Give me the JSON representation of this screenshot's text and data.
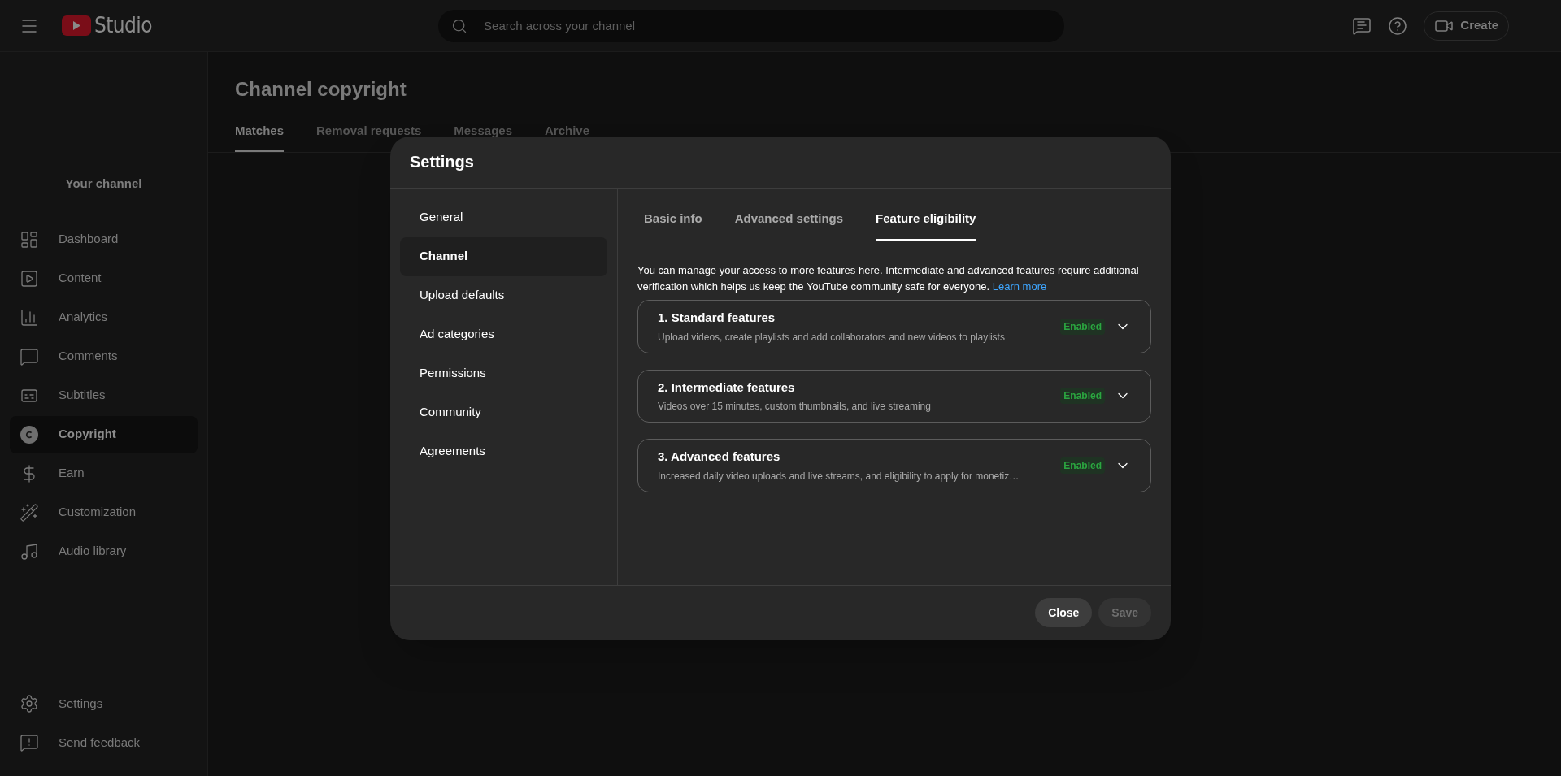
{
  "topbar": {
    "logo_text": "Studio",
    "search": {
      "placeholder": "Search across your channel"
    },
    "create_button": "Create"
  },
  "sidebar": {
    "channel_label": "Your channel",
    "items": [
      {
        "label": "Dashboard",
        "selected": false
      },
      {
        "label": "Content",
        "selected": false
      },
      {
        "label": "Analytics",
        "selected": false
      },
      {
        "label": "Comments",
        "selected": false
      },
      {
        "label": "Subtitles",
        "selected": false
      },
      {
        "label": "Copyright",
        "selected": true
      },
      {
        "label": "Earn",
        "selected": false
      },
      {
        "label": "Customization",
        "selected": false
      },
      {
        "label": "Audio library",
        "selected": false
      }
    ],
    "bottom_items": [
      {
        "label": "Settings"
      },
      {
        "label": "Send feedback"
      }
    ]
  },
  "page": {
    "title": "Channel copyright",
    "tabs": [
      {
        "label": "Matches",
        "selected": true
      },
      {
        "label": "Removal requests",
        "selected": false
      },
      {
        "label": "Messages",
        "selected": false
      },
      {
        "label": "Archive",
        "selected": false
      }
    ]
  },
  "dialog": {
    "title": "Settings",
    "nav": [
      {
        "label": "General",
        "selected": false
      },
      {
        "label": "Channel",
        "selected": true
      },
      {
        "label": "Upload defaults",
        "selected": false
      },
      {
        "label": "Ad categories",
        "selected": false
      },
      {
        "label": "Permissions",
        "selected": false
      },
      {
        "label": "Community",
        "selected": false
      },
      {
        "label": "Agreements",
        "selected": false
      }
    ],
    "tabs": [
      {
        "label": "Basic info",
        "selected": false
      },
      {
        "label": "Advanced settings",
        "selected": false
      },
      {
        "label": "Feature eligibility",
        "selected": true
      }
    ],
    "intro": "You can manage your access to more features here. Intermediate and advanced features require additional verification which helps us keep the YouTube community safe for everyone.",
    "learn_more": "Learn more",
    "features": [
      {
        "title": "1. Standard features",
        "description": "Upload videos, create playlists and add collaborators and new videos to playlists",
        "status": "Enabled",
        "expanded": false
      },
      {
        "title": "2. Intermediate features",
        "description": "Videos over 15 minutes, custom thumbnails, and live streaming",
        "status": "Enabled",
        "expanded": false
      },
      {
        "title": "3. Advanced features",
        "description": "Increased daily video uploads and live streams, and eligibility to apply for monetiz…",
        "status": "Enabled",
        "expanded": false
      }
    ],
    "buttons": [
      {
        "label": "Close",
        "disabled": false
      },
      {
        "label": "Save",
        "disabled": true
      }
    ]
  }
}
